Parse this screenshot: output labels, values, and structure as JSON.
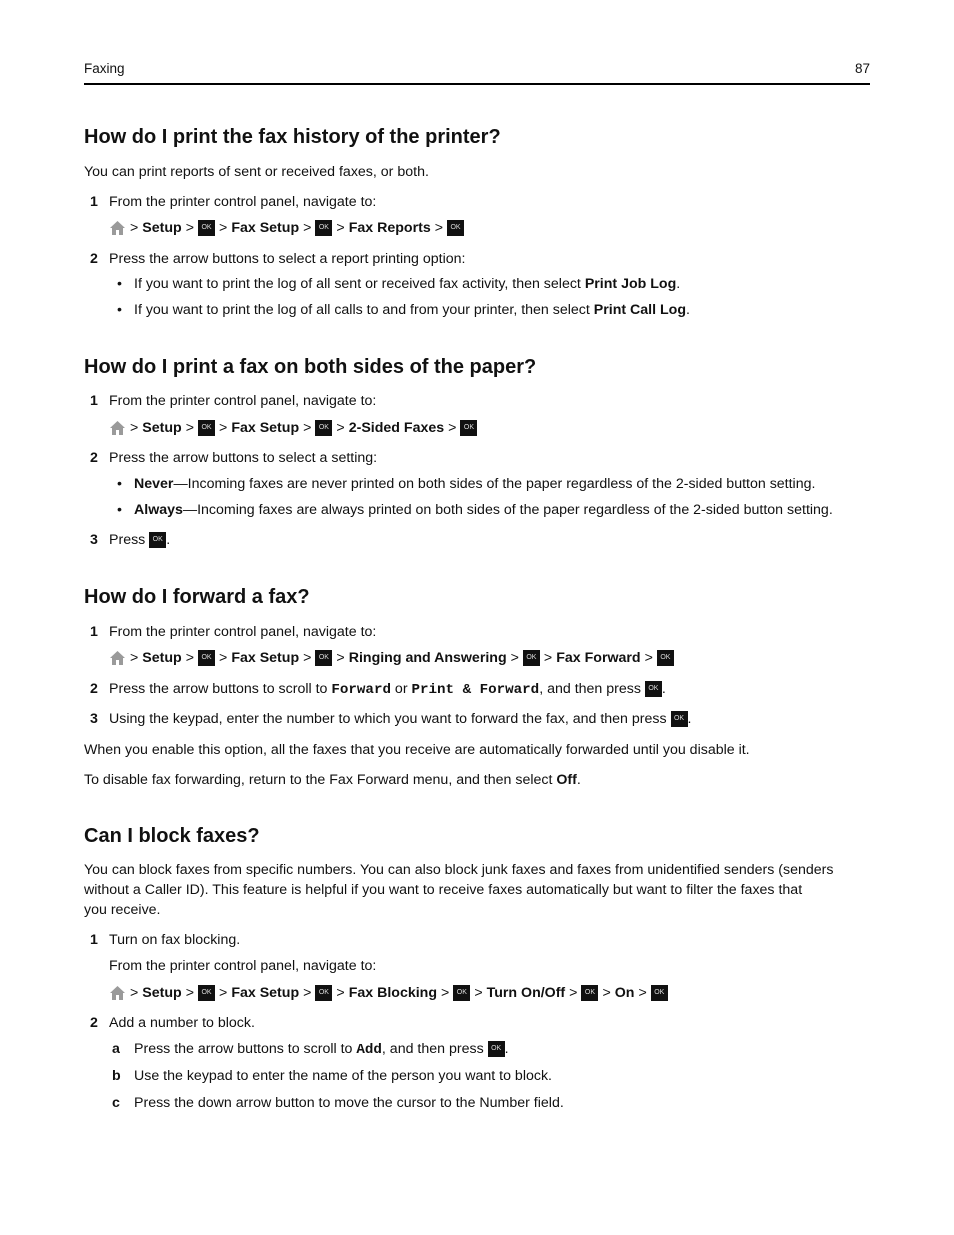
{
  "header": {
    "section": "Faxing",
    "page": "87"
  },
  "s1": {
    "title": "How do I print the fax history of the printer?",
    "intro": "You can print reports of sent or received faxes, or both.",
    "step1": "From the printer control panel, navigate to:",
    "nav": [
      "Setup",
      "Fax Setup",
      "Fax Reports"
    ],
    "step2": "Press the arrow buttons to select a report printing option:",
    "b1_pre": "If you want to print the log of all sent or received fax activity, then select ",
    "b1_bold": "Print Job Log",
    "b2_pre": "If you want to print the log of all calls to and from your printer, then select ",
    "b2_bold": "Print Call Log"
  },
  "s2": {
    "title": "How do I print a fax on both sides of the paper?",
    "step1": "From the printer control panel, navigate to:",
    "nav": [
      "Setup",
      "Fax Setup",
      "2-Sided Faxes"
    ],
    "step2": "Press the arrow buttons to select a setting:",
    "b1_bold": "Never",
    "b1_rest": "—Incoming faxes are never printed on both sides of the paper regardless of the 2-sided button setting.",
    "b2_bold": "Always",
    "b2_rest": "—Incoming faxes are always printed on both sides of the paper regardless of the 2-sided button setting.",
    "step3": "Press"
  },
  "s3": {
    "title": "How do I forward a fax?",
    "step1": "From the printer control panel, navigate to:",
    "nav": [
      "Setup",
      "Fax Setup",
      "Ringing and Answering",
      "Fax Forward"
    ],
    "step2_a": "Press the arrow buttons to scroll to ",
    "step2_m1": "Forward",
    "step2_b": " or ",
    "step2_m2": "Print & Forward",
    "step2_c": ", and then press",
    "step3": "Using the keypad, enter the number to which you want to forward the fax, and then press",
    "p1": "When you enable this option, all the faxes that you receive are automatically forwarded until you disable it.",
    "p2_pre": "To disable fax forwarding, return to the Fax Forward menu, and then select ",
    "p2_bold": "Off"
  },
  "s4": {
    "title": "Can I block faxes?",
    "intro1": "You can block faxes from specific numbers. You can also block junk faxes and faxes from unidentified senders (senders",
    "intro2": "without a Caller ID). This feature is helpful if you want to receive faxes automatically but want to filter the faxes that",
    "intro3": "you receive.",
    "step1": "Turn on fax blocking.",
    "step1_sub": "From the printer control panel, navigate to:",
    "nav": [
      "Setup",
      "Fax Setup",
      "Fax Blocking",
      "Turn On/Off",
      "On"
    ],
    "step2": "Add a number to block.",
    "a_pre": "Press the arrow buttons to scroll to ",
    "a_mono": "Add",
    "a_post": ", and then press",
    "b": "Use the keypad to enter the name of the person you want to block.",
    "c": "Press the down arrow button to move the cursor to the Number field."
  },
  "ok_label": "OK",
  "nums": [
    "1",
    "2",
    "3"
  ],
  "letters": [
    "a",
    "b",
    "c"
  ]
}
